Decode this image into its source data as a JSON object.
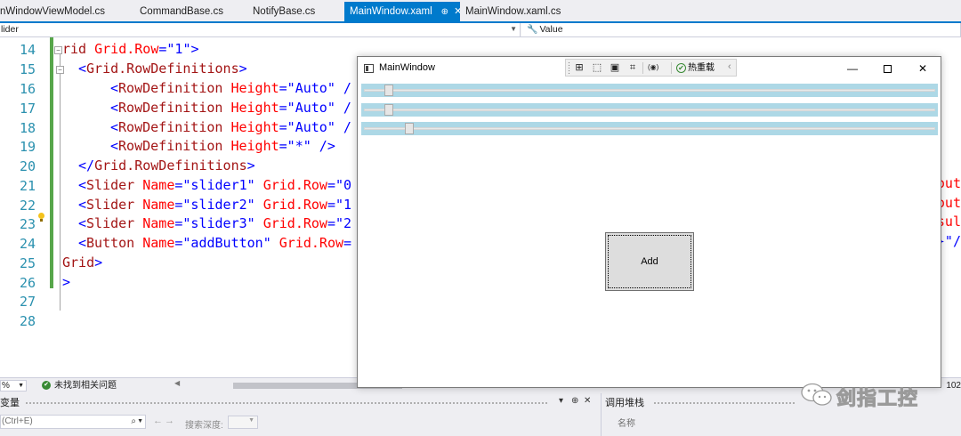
{
  "tabs": [
    {
      "label": "nWindowViewModel.cs",
      "active": false
    },
    {
      "label": "CommandBase.cs",
      "active": false
    },
    {
      "label": "NotifyBase.cs",
      "active": false
    },
    {
      "label": "MainWindow.xaml",
      "active": true,
      "pin": "⊕",
      "close": "✕"
    },
    {
      "label": "MainWindow.xaml.cs",
      "active": false
    }
  ],
  "navbar": {
    "left_value": "lider",
    "right_value": "Value"
  },
  "editor": {
    "line_numbers": [
      "14",
      "15",
      "16",
      "17",
      "18",
      "19",
      "20",
      "21",
      "22",
      "23",
      "24",
      "25",
      "26",
      "27",
      "28"
    ],
    "code": {
      "l14": {
        "a": "rid ",
        "b": "Grid.Row",
        "c": "=\"1\">"
      },
      "l15": {
        "a": "<",
        "b": "Grid.RowDefinitions",
        "c": ">"
      },
      "l16": {
        "a": "<",
        "b": "RowDefinition",
        "c": " Height",
        "d": "=\"Auto\" /"
      },
      "l17": {
        "a": "<",
        "b": "RowDefinition",
        "c": " Height",
        "d": "=\"Auto\" /"
      },
      "l18": {
        "a": "<",
        "b": "RowDefinition",
        "c": " Height",
        "d": "=\"Auto\" /"
      },
      "l19": {
        "a": "<",
        "b": "RowDefinition",
        "c": " Height",
        "d": "=\"*\" />"
      },
      "l20": {
        "a": "</",
        "b": "Grid.RowDefinitions",
        "c": ">"
      },
      "l21": {
        "a": "<",
        "b": "Slider",
        "c": " Name",
        "d": "=\"slider1\"",
        "e": " Grid.Row",
        "f": "=\"0"
      },
      "l22": {
        "a": "<",
        "b": "Slider",
        "c": " Name",
        "d": "=\"slider2\"",
        "e": " Grid.Row",
        "f": "=\"1"
      },
      "l23": {
        "a": "<",
        "b": "Slider",
        "c": " Name",
        "d": "=\"slider3\"",
        "e": " Grid.Row",
        "f": "=\"2"
      },
      "l24": {
        "a": "<",
        "b": "Button",
        "c": " Name",
        "d": "=\"addButton\"",
        "e": " Grid.Row",
        "f": "="
      },
      "l25": {
        "a": "Grid",
        "b": ">"
      },
      "l26": {
        "a": ">"
      }
    },
    "edge_text": {
      "l21": "out",
      "l22": "out",
      "l23": "sul",
      "l24": "}\"/"
    }
  },
  "status": {
    "zoom": "%",
    "issues": "未找到相关问题",
    "ratio": "102"
  },
  "bottom": {
    "left_title": "变量",
    "search_placeholder": "(Ctrl+E)",
    "depth_label": "搜索深度:",
    "right_title": "调用堆栈",
    "col_name": "名称"
  },
  "wpf_window": {
    "title": "MainWindow",
    "hot_reload": "热重载",
    "button_label": "Add",
    "sliders": [
      {
        "name": "slider1",
        "fraction": 0.04
      },
      {
        "name": "slider2",
        "fraction": 0.04
      },
      {
        "name": "slider3",
        "fraction": 0.076
      }
    ]
  },
  "watermark": {
    "text": "剑指工控"
  },
  "colors": {
    "accent": "#007acc",
    "slider_background": "#add8e6",
    "xaml_tag": "#a31515",
    "xaml_attribute": "#ff0000",
    "xaml_value": "#0000ff",
    "line_number": "#2b91af",
    "change_bar": "#57a64a"
  }
}
